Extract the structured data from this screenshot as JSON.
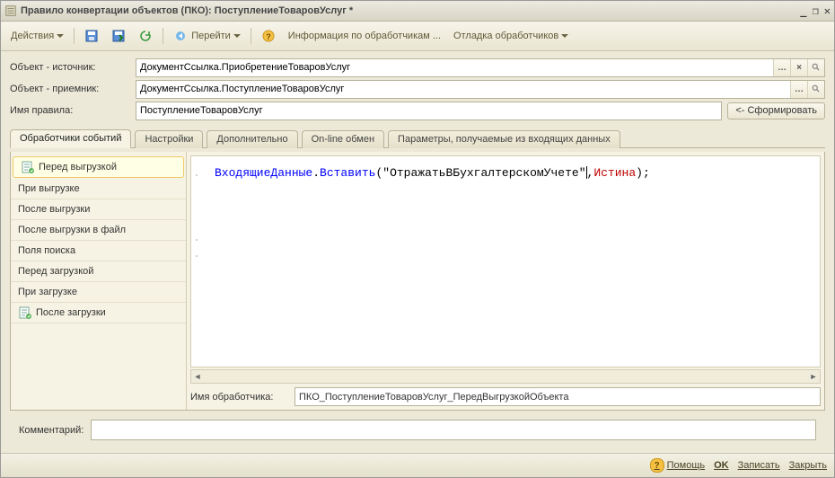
{
  "title": "Правило конвертации объектов (ПКО): ПоступлениеТоваровУслуг *",
  "toolbar": {
    "actions": "Действия",
    "go_to": "Перейти",
    "handlers_info": "Информация по обработчикам ...",
    "debug_handlers": "Отладка обработчиков"
  },
  "fields": {
    "source_label": "Объект - источник:",
    "source_value": "ДокументСсылка.ПриобретениеТоваровУслуг",
    "dest_label": "Объект - приемник:",
    "dest_value": "ДокументСсылка.ПоступлениеТоваровУслуг",
    "rulename_label": "Имя правила:",
    "rulename_value": "ПоступлениеТоваровУслуг",
    "generate_btn": "<- Сформировать"
  },
  "tabs": {
    "t0": "Обработчики событий",
    "t1": "Настройки",
    "t2": "Дополнительно",
    "t3": "On-line обмен",
    "t4": "Параметры, получаемые из входящих данных"
  },
  "event_list": [
    "Перед выгрузкой",
    "При выгрузке",
    "После выгрузки",
    "После выгрузки в файл",
    "Поля поиска",
    "Перед загрузкой",
    "При загрузке",
    "После загрузки"
  ],
  "selected_event_index": 0,
  "code": {
    "line1": {
      "obj": "ВходящиеДанные",
      "dot": ".",
      "method": "Вставить",
      "open": "(",
      "str": "\"ОтражатьВБухгалтерскомУчете\"",
      "comma": ",",
      "kw": "Истина",
      "close": ");"
    }
  },
  "handler": {
    "label": "Имя обработчика:",
    "value": "ПКО_ПоступлениеТоваровУслуг_ПередВыгрузкойОбъекта"
  },
  "comment": {
    "label": "Комментарий:",
    "value": ""
  },
  "footer": {
    "help": "Помощь",
    "ok": "OK",
    "save": "Записать",
    "close": "Закрыть"
  }
}
